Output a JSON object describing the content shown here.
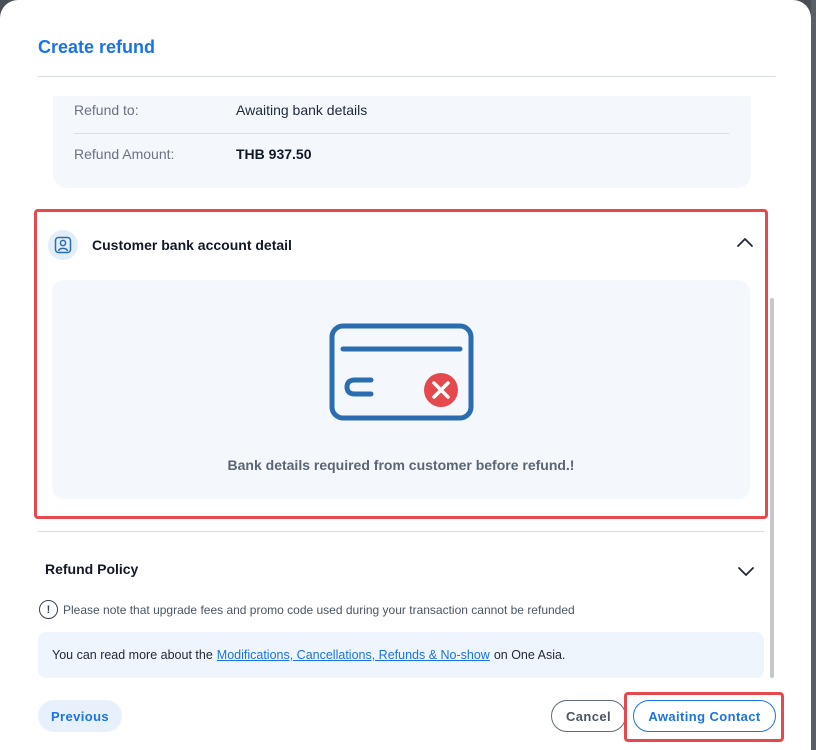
{
  "modal": {
    "title": "Create refund"
  },
  "summary": {
    "refund_to_label": "Refund to:",
    "refund_to_value": "Awaiting bank details",
    "refund_amount_label": "Refund Amount:",
    "refund_amount_value": "THB 937.50"
  },
  "bank_section": {
    "title": "Customer bank account detail",
    "empty_message": "Bank details required from customer before refund.!",
    "icons": {
      "section": "user-account-icon",
      "collapse": "chevron-up-icon",
      "illustration": "credit-card-error-icon"
    }
  },
  "policy": {
    "title": "Refund Policy",
    "note": "Please note that upgrade fees and promo code used during your transaction cannot be refunded",
    "read_more_prefix": "You can read more about the",
    "read_more_link": "Modifications, Cancellations, Refunds & No-show",
    "read_more_suffix": "on One Asia.",
    "icons": {
      "toggle": "chevron-down-icon",
      "note": "info-icon"
    }
  },
  "footer": {
    "previous_label": "Previous",
    "cancel_label": "Cancel",
    "awaiting_label": "Awaiting Contact"
  },
  "colors": {
    "accent": "#1a73e8",
    "highlight": "#e5484d",
    "error": "#e5484d",
    "card_bg": "#f4f8fc",
    "card_icon": "#2a6db0"
  }
}
